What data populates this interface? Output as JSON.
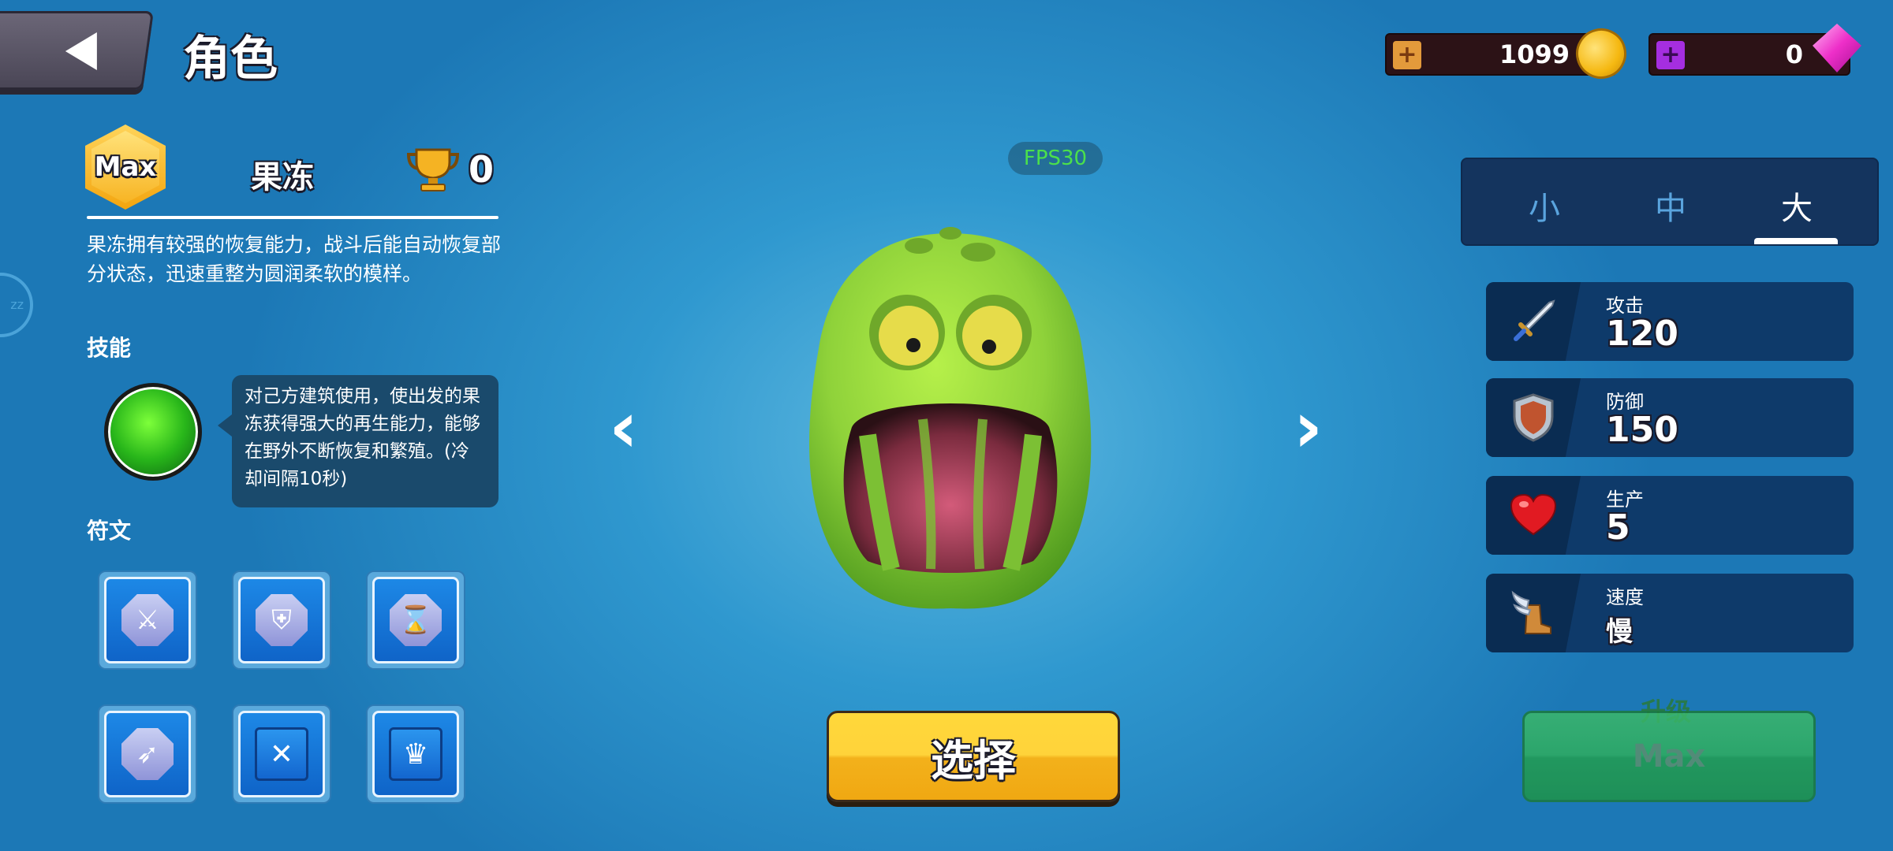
{
  "header": {
    "title": "角色",
    "gold": "1099",
    "gems": "0"
  },
  "character": {
    "level_badge": "Max",
    "name": "果冻",
    "trophies": "0",
    "description": "果冻拥有较强的恢复能力，战斗后能自动恢复部分状态，迅速重整为圆润柔软的模样。"
  },
  "skill": {
    "section_label": "技能",
    "description": "对己方建筑使用，使出发的果冻获得强大的再生能力，能够在野外不断恢复和繁殖。(冷却间隔10秒)"
  },
  "runes": {
    "section_label": "符文",
    "items": [
      "sword-rune",
      "shield-rune",
      "hourglass-rune",
      "speed-rune",
      "crossed-swords-rune",
      "crown-rune"
    ]
  },
  "center": {
    "fps": "FPS30",
    "select_label": "选择"
  },
  "size_tabs": {
    "items": [
      "小",
      "中",
      "大"
    ],
    "active": "大"
  },
  "stats": [
    {
      "label": "攻击",
      "value": "120",
      "icon": "sword-icon"
    },
    {
      "label": "防御",
      "value": "150",
      "icon": "shield-icon"
    },
    {
      "label": "生产",
      "value": "5",
      "icon": "heart-icon"
    },
    {
      "label": "速度",
      "value": "慢",
      "icon": "winged-boot-icon"
    }
  ],
  "upgrade": {
    "label": "升级",
    "button": "Max"
  },
  "colors": {
    "accent_yellow": "#ffd33a",
    "upgrade_green": "#2fae5f",
    "fps_green": "#4be04b"
  }
}
